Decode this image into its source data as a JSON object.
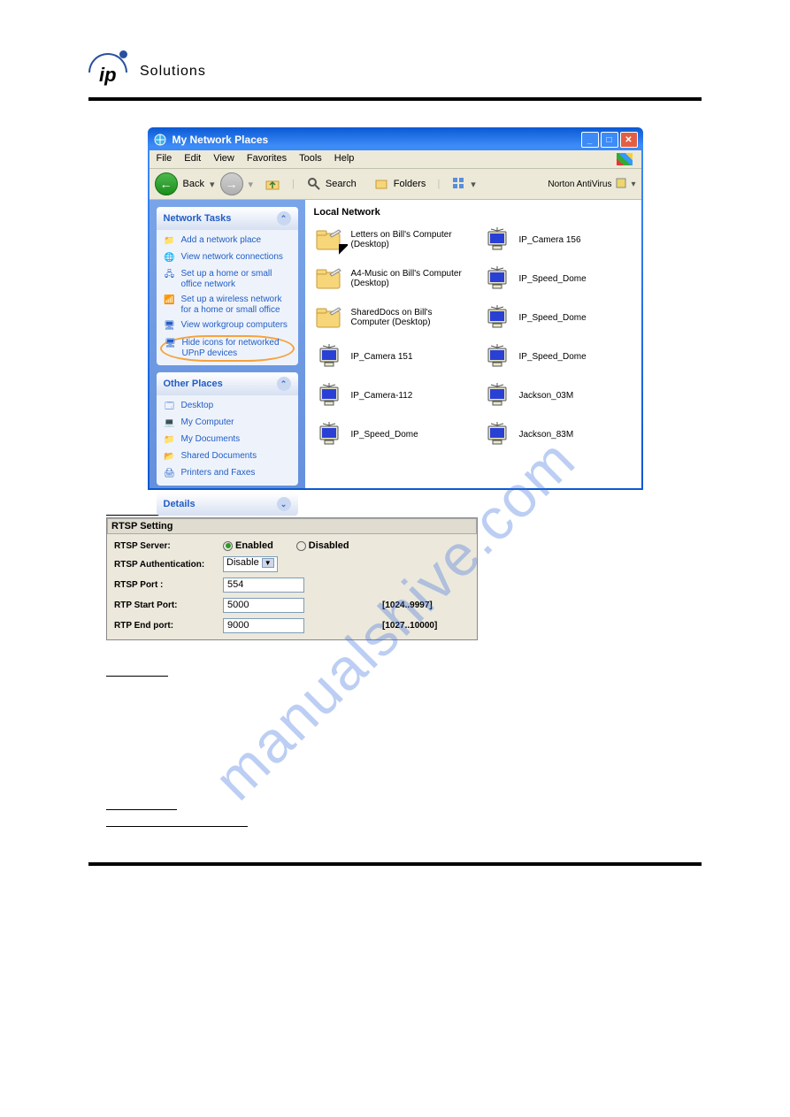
{
  "logo_text": "Solutions",
  "watermark": "manualshive.com",
  "window": {
    "title": "My Network Places",
    "menu": [
      "File",
      "Edit",
      "View",
      "Favorites",
      "Tools",
      "Help"
    ],
    "toolbar": {
      "back": "Back",
      "search": "Search",
      "folders": "Folders",
      "antivirus": "Norton AntiVirus"
    },
    "sidebar": {
      "network_tasks": {
        "title": "Network Tasks",
        "items": [
          "Add a network place",
          "View network connections",
          "Set up a home or small office network",
          "Set up a wireless network for a home or small office",
          "View workgroup computers",
          "Hide icons for networked UPnP devices"
        ]
      },
      "other_places": {
        "title": "Other Places",
        "items": [
          "Desktop",
          "My Computer",
          "My Documents",
          "Shared Documents",
          "Printers and Faxes"
        ]
      },
      "details_title": "Details"
    },
    "main_heading": "Local Network",
    "devices_left": [
      {
        "type": "folder",
        "label": "Letters on Bill's Computer (Desktop)"
      },
      {
        "type": "folder",
        "label": "A4-Music on Bill's Computer (Desktop)"
      },
      {
        "type": "folder",
        "label": "SharedDocs on Bill's Computer (Desktop)"
      },
      {
        "type": "monitor",
        "label": "IP_Camera 151"
      },
      {
        "type": "monitor",
        "label": "IP_Camera-112"
      },
      {
        "type": "monitor",
        "label": "IP_Speed_Dome"
      }
    ],
    "devices_right": [
      {
        "type": "monitor",
        "label": "IP_Camera 156"
      },
      {
        "type": "monitor",
        "label": "IP_Speed_Dome"
      },
      {
        "type": "monitor",
        "label": "IP_Speed_Dome"
      },
      {
        "type": "monitor",
        "label": "IP_Speed_Dome"
      },
      {
        "type": "monitor",
        "label": "Jackson_03M"
      },
      {
        "type": "monitor",
        "label": "Jackson_83M"
      }
    ]
  },
  "rtsp": {
    "title": "RTSP Setting",
    "rows": {
      "server_label": "RTSP Server:",
      "enabled": "Enabled",
      "disabled": "Disabled",
      "auth_label": "RTSP Authentication:",
      "auth_value": "Disable",
      "port_label": "RTSP Port :",
      "port_value": "554",
      "start_label": "RTP Start Port:",
      "start_value": "5000",
      "start_range": "[1024..9997]",
      "end_label": "RTP End port:",
      "end_value": "9000",
      "end_range": "[1027..10000]"
    }
  }
}
